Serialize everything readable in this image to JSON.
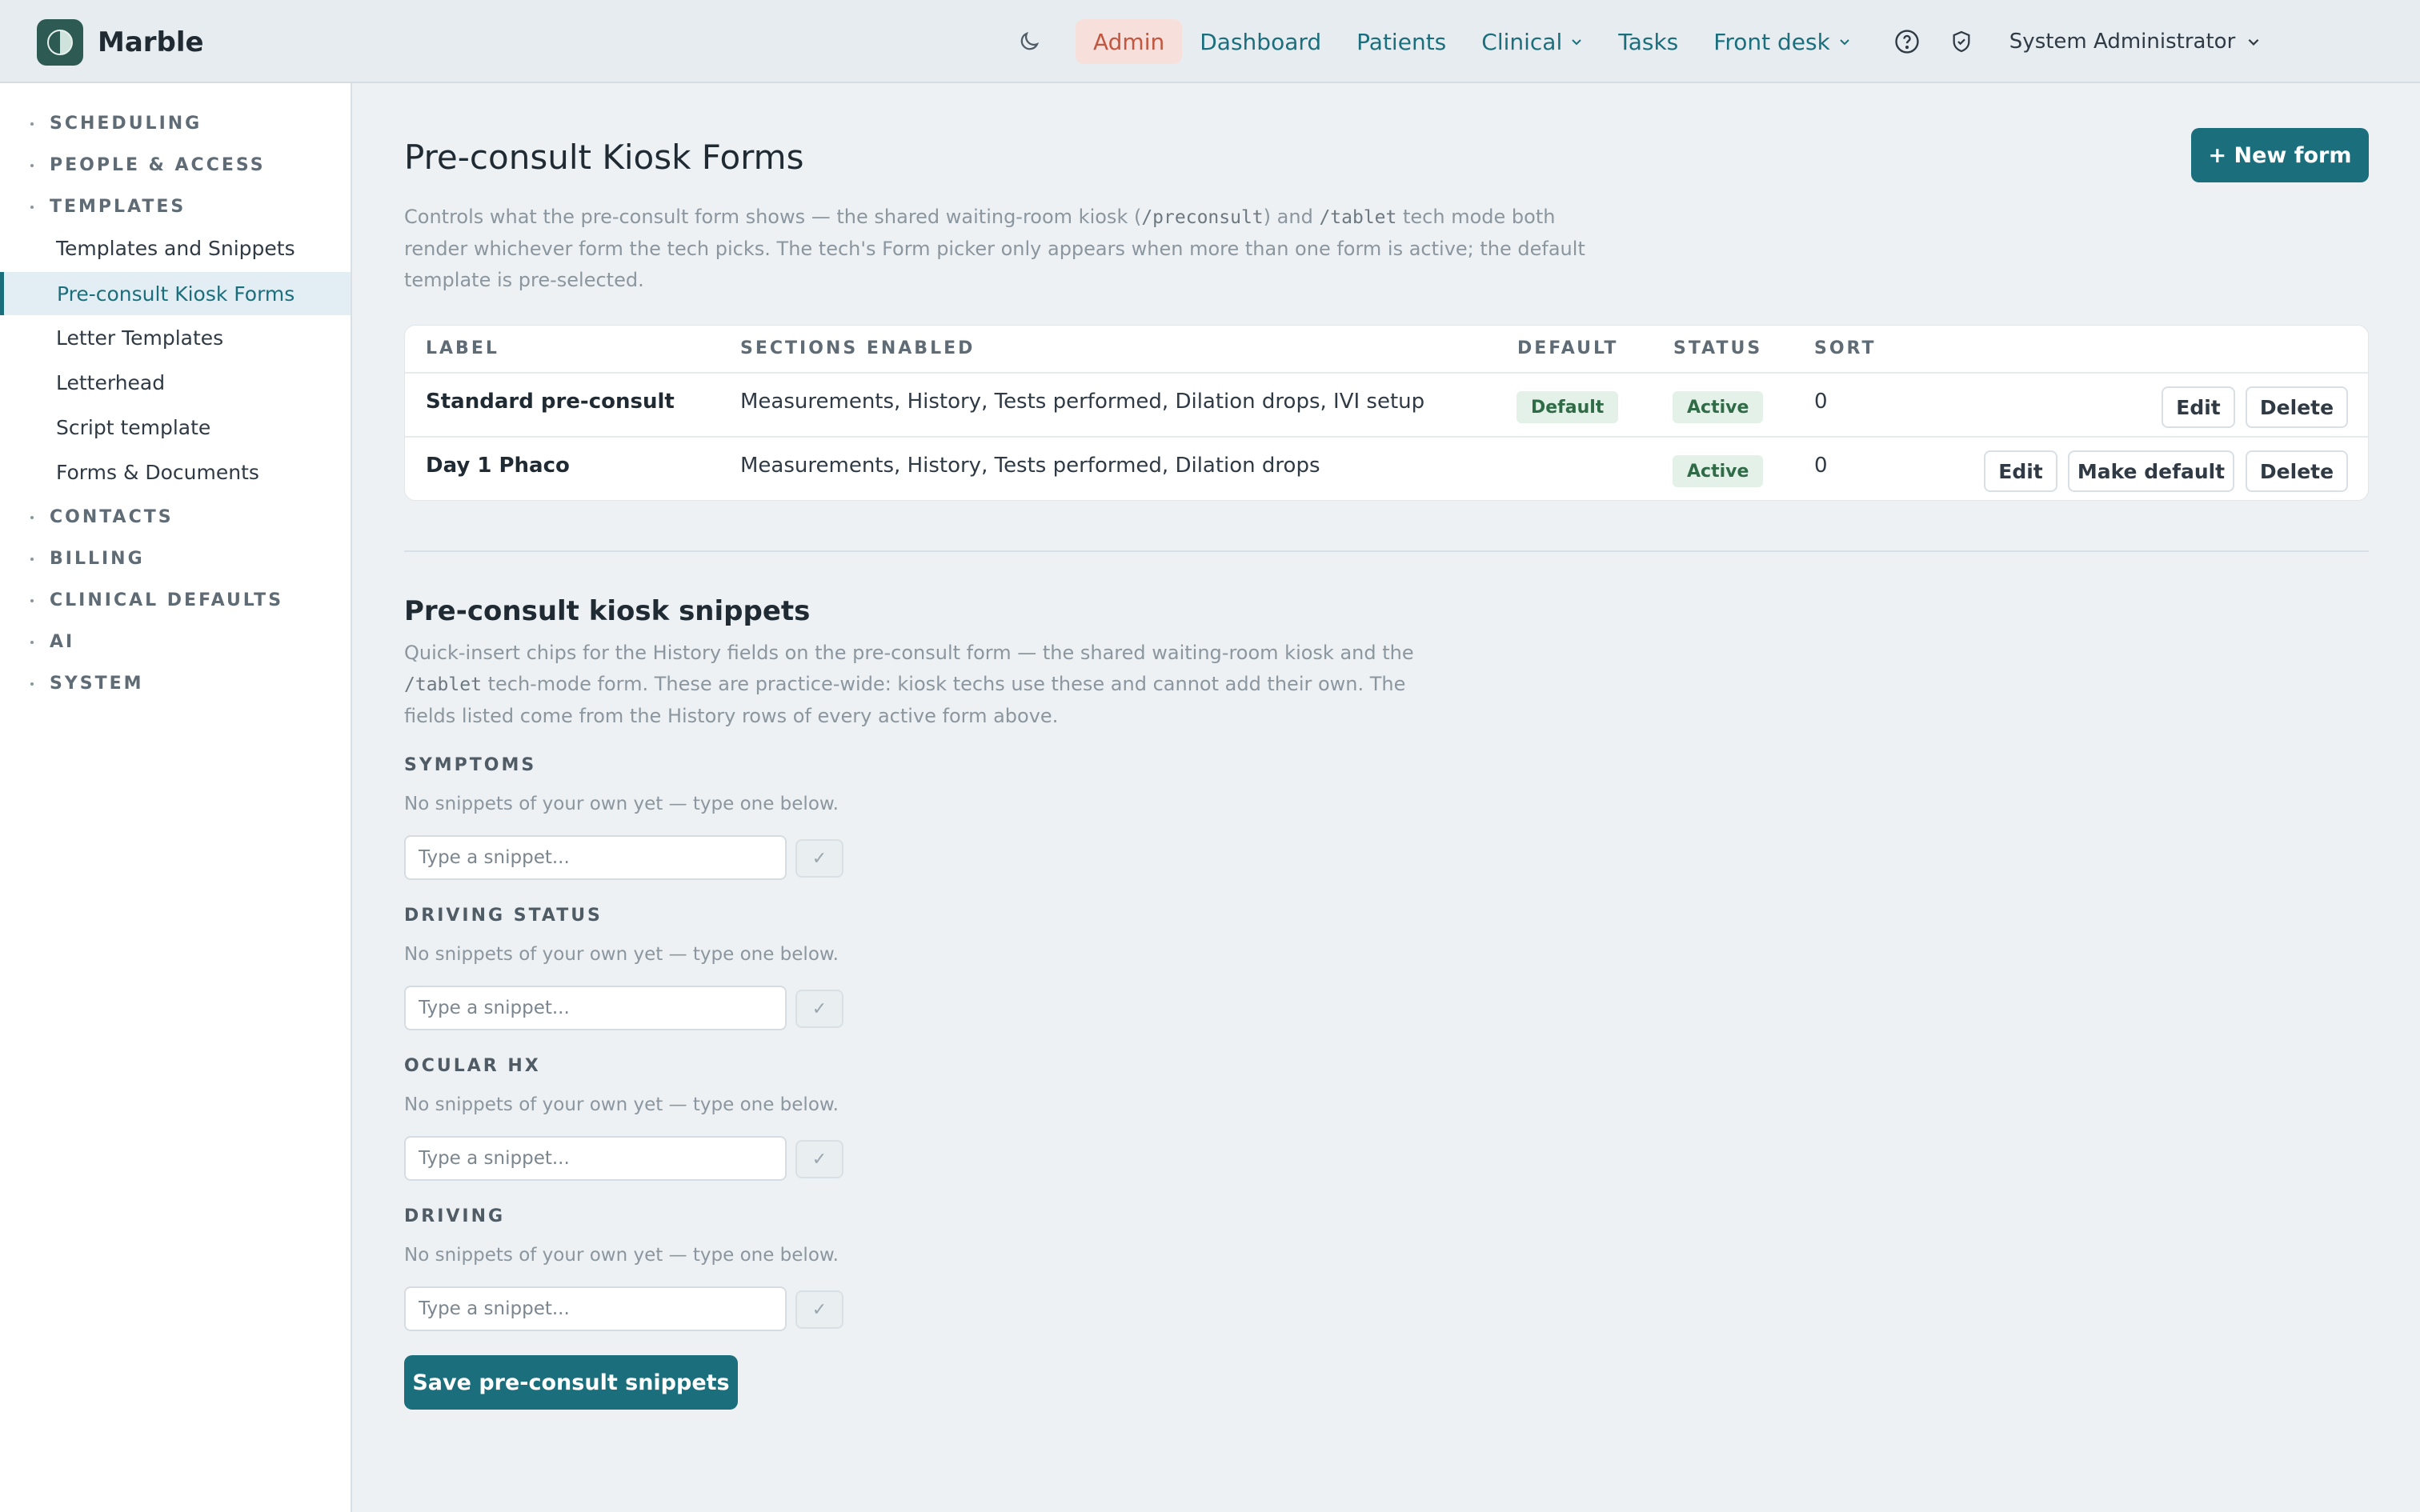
{
  "app": {
    "name": "Marble"
  },
  "nav": {
    "items": [
      {
        "label": "Admin"
      },
      {
        "label": "Dashboard"
      },
      {
        "label": "Patients"
      },
      {
        "label": "Clinical"
      },
      {
        "label": "Tasks"
      },
      {
        "label": "Front desk"
      }
    ],
    "user": "System Administrator"
  },
  "sidebar": {
    "groups": [
      {
        "label": "SCHEDULING"
      },
      {
        "label": "PEOPLE & ACCESS"
      },
      {
        "label": "TEMPLATES"
      },
      {
        "label": "CONTACTS"
      },
      {
        "label": "BILLING"
      },
      {
        "label": "CLINICAL DEFAULTS"
      },
      {
        "label": "AI"
      },
      {
        "label": "SYSTEM"
      }
    ],
    "templates_items": [
      {
        "label": "Templates and Snippets"
      },
      {
        "label": "Pre-consult Kiosk Forms"
      },
      {
        "label": "Letter Templates"
      },
      {
        "label": "Letterhead"
      },
      {
        "label": "Script template"
      },
      {
        "label": "Forms & Documents"
      }
    ]
  },
  "page": {
    "title": "Pre-consult Kiosk Forms",
    "new_button": "+ New form",
    "desc_1": "Controls what the pre-consult form shows — the shared waiting-room kiosk (",
    "desc_code_1": "/preconsult",
    "desc_2": ") and ",
    "desc_code_2": "/tablet",
    "desc_3": " tech mode both render whichever form the tech picks. The tech's Form picker only appears when more than one form is active; the default template is pre-selected."
  },
  "table": {
    "headers": {
      "label": "LABEL",
      "sections": "SECTIONS ENABLED",
      "default": "DEFAULT",
      "status": "STATUS",
      "sort": "SORT"
    },
    "rows": [
      {
        "label": "Standard pre-consult",
        "sections": "Measurements, History, Tests performed, Dilation drops, IVI setup",
        "default": "Default",
        "status": "Active",
        "sort": "0",
        "edit": "Edit",
        "delete": "Delete"
      },
      {
        "label": "Day 1 Phaco",
        "sections": "Measurements, History, Tests performed, Dilation drops",
        "status": "Active",
        "sort": "0",
        "edit": "Edit",
        "make_default": "Make default",
        "delete": "Delete"
      }
    ]
  },
  "snippets": {
    "title": "Pre-consult kiosk snippets",
    "desc_1": "Quick-insert chips for the History fields on the pre-consult form — the shared waiting-room kiosk and the ",
    "desc_code": "/tablet",
    "desc_2": " tech-mode form. These are practice-wide: kiosk techs use these and cannot add their own. The fields listed come from the History rows of every active form above.",
    "fields": [
      {
        "label": "SYMPTOMS",
        "hint": "No snippets of your own yet — type one below.",
        "placeholder": "Type a snippet..."
      },
      {
        "label": "DRIVING STATUS",
        "hint": "No snippets of your own yet — type one below.",
        "placeholder": "Type a snippet..."
      },
      {
        "label": "OCULAR HX",
        "hint": "No snippets of your own yet — type one below.",
        "placeholder": "Type a snippet..."
      },
      {
        "label": "DRIVING",
        "hint": "No snippets of your own yet — type one below.",
        "placeholder": "Type a snippet..."
      }
    ],
    "save_button": "Save pre-consult snippets"
  }
}
